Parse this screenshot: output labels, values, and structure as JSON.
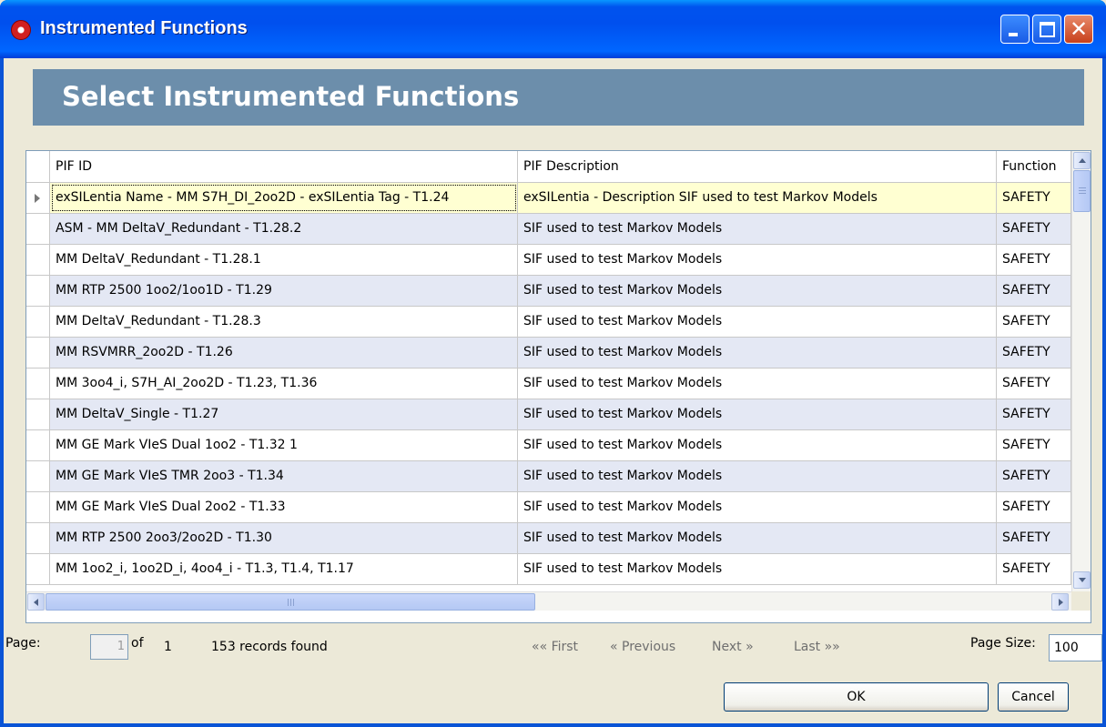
{
  "window": {
    "title": "Instrumented Functions",
    "icon": "app-red-dot-icon",
    "controls": [
      "minimize-icon",
      "maximize-icon",
      "close-icon"
    ]
  },
  "header": {
    "title": "Select Instrumented Functions"
  },
  "grid": {
    "columns": [
      "PIF ID",
      "PIF Description",
      "Function"
    ],
    "rows": [
      {
        "id": "exSILentia Name - MM S7H_DI_2oo2D - exSILentia Tag - T1.24",
        "desc": "exSILentia - Description SIF used to test Markov Models",
        "func": "SAFETY",
        "selected": true
      },
      {
        "id": "ASM - MM DeltaV_Redundant - T1.28.2",
        "desc": "SIF used to test Markov Models",
        "func": "SAFETY"
      },
      {
        "id": "MM DeltaV_Redundant - T1.28.1",
        "desc": "SIF used to test Markov Models",
        "func": "SAFETY"
      },
      {
        "id": "MM RTP 2500 1oo2/1oo1D - T1.29",
        "desc": "SIF used to test Markov Models",
        "func": "SAFETY"
      },
      {
        "id": "MM DeltaV_Redundant - T1.28.3",
        "desc": "SIF used to test Markov Models",
        "func": "SAFETY"
      },
      {
        "id": "MM RSVMRR_2oo2D - T1.26",
        "desc": "SIF used to test Markov Models",
        "func": "SAFETY"
      },
      {
        "id": "MM 3oo4_i, S7H_AI_2oo2D - T1.23, T1.36",
        "desc": "SIF used to test Markov Models",
        "func": "SAFETY"
      },
      {
        "id": "MM DeltaV_Single - T1.27",
        "desc": "SIF used to test Markov Models",
        "func": "SAFETY"
      },
      {
        "id": "MM GE Mark VIeS Dual 1oo2 - T1.32 1",
        "desc": "SIF used to test Markov Models",
        "func": "SAFETY"
      },
      {
        "id": "MM GE Mark VIeS TMR 2oo3 - T1.34",
        "desc": "SIF used to test Markov Models",
        "func": "SAFETY"
      },
      {
        "id": "MM GE Mark VIeS Dual 2oo2 - T1.33",
        "desc": "SIF used to test Markov Models",
        "func": "SAFETY"
      },
      {
        "id": "MM RTP 2500 2oo3/2oo2D - T1.30",
        "desc": "SIF used to test Markov Models",
        "func": "SAFETY"
      },
      {
        "id": "MM 1oo2_i, 1oo2D_i, 4oo4_i - T1.3, T1.4, T1.17",
        "desc": "SIF used to test Markov Models",
        "func": "SAFETY"
      }
    ],
    "hscroll_grip": "III"
  },
  "pager": {
    "page_label": "Page:",
    "page_value": "1",
    "of_label": "of",
    "total_pages": "1",
    "records": "153 records found",
    "first": "«« First",
    "previous": "« Previous",
    "next": "Next »",
    "last": "Last »»",
    "page_size_label": "Page Size:",
    "page_size_value": "100"
  },
  "buttons": {
    "ok": "OK",
    "cancel": "Cancel"
  }
}
